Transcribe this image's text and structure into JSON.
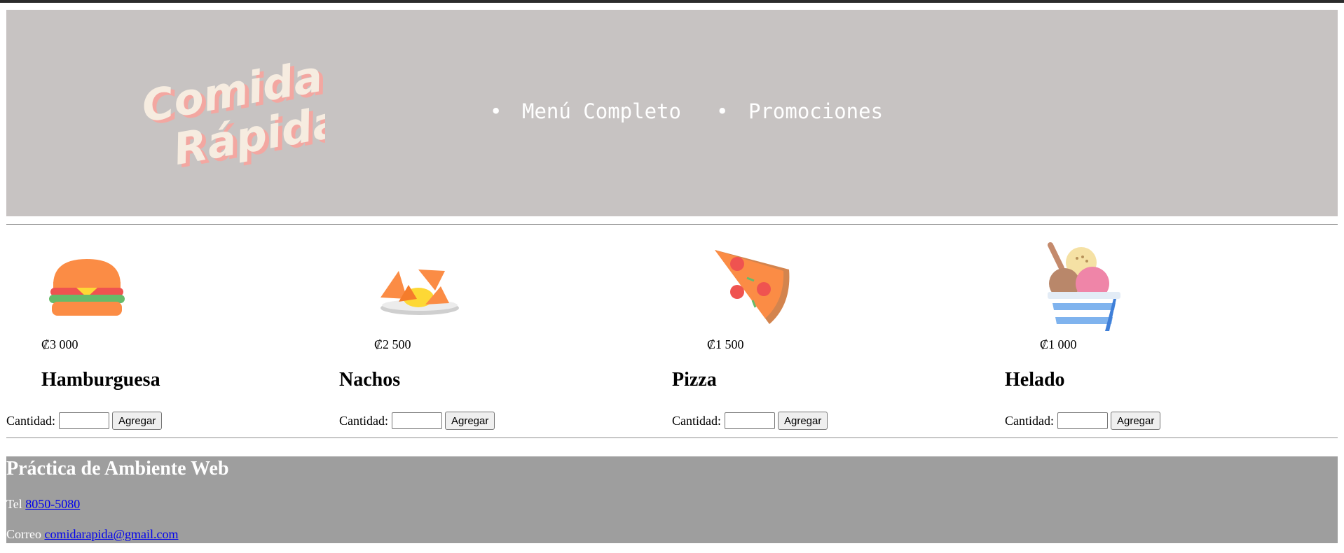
{
  "header": {
    "logo_line1": "Comida",
    "logo_line2": "Rápida",
    "nav": [
      {
        "label": "Menú Completo"
      },
      {
        "label": "Promociones"
      }
    ]
  },
  "products": [
    {
      "icon": "hamburger-icon",
      "price": "₡3 000",
      "name": "Hamburguesa",
      "qty_label": "Cantidad:",
      "qty_value": "",
      "button": "Agregar"
    },
    {
      "icon": "nachos-icon",
      "price": "₡2 500",
      "name": "Nachos",
      "qty_label": "Cantidad:",
      "qty_value": "",
      "button": "Agregar"
    },
    {
      "icon": "pizza-icon",
      "price": "₡1 500",
      "name": "Pizza",
      "qty_label": "Cantidad:",
      "qty_value": "",
      "button": "Agregar"
    },
    {
      "icon": "ice-cream-icon",
      "price": "₡1 000",
      "name": "Helado",
      "qty_label": "Cantidad:",
      "qty_value": "",
      "button": "Agregar"
    }
  ],
  "footer": {
    "title": "Práctica de Ambiente Web",
    "tel_label": "Tel",
    "tel_value": "8050-5080",
    "email_label": "Correo",
    "email_value": "comidarapida@gmail.com"
  },
  "colors": {
    "header_bg": "#c7c3c2",
    "footer_bg": "#9e9e9e",
    "link": "#0000ee",
    "logo_fill": "#f6ece0",
    "logo_shadow": "#f3a7a1"
  }
}
